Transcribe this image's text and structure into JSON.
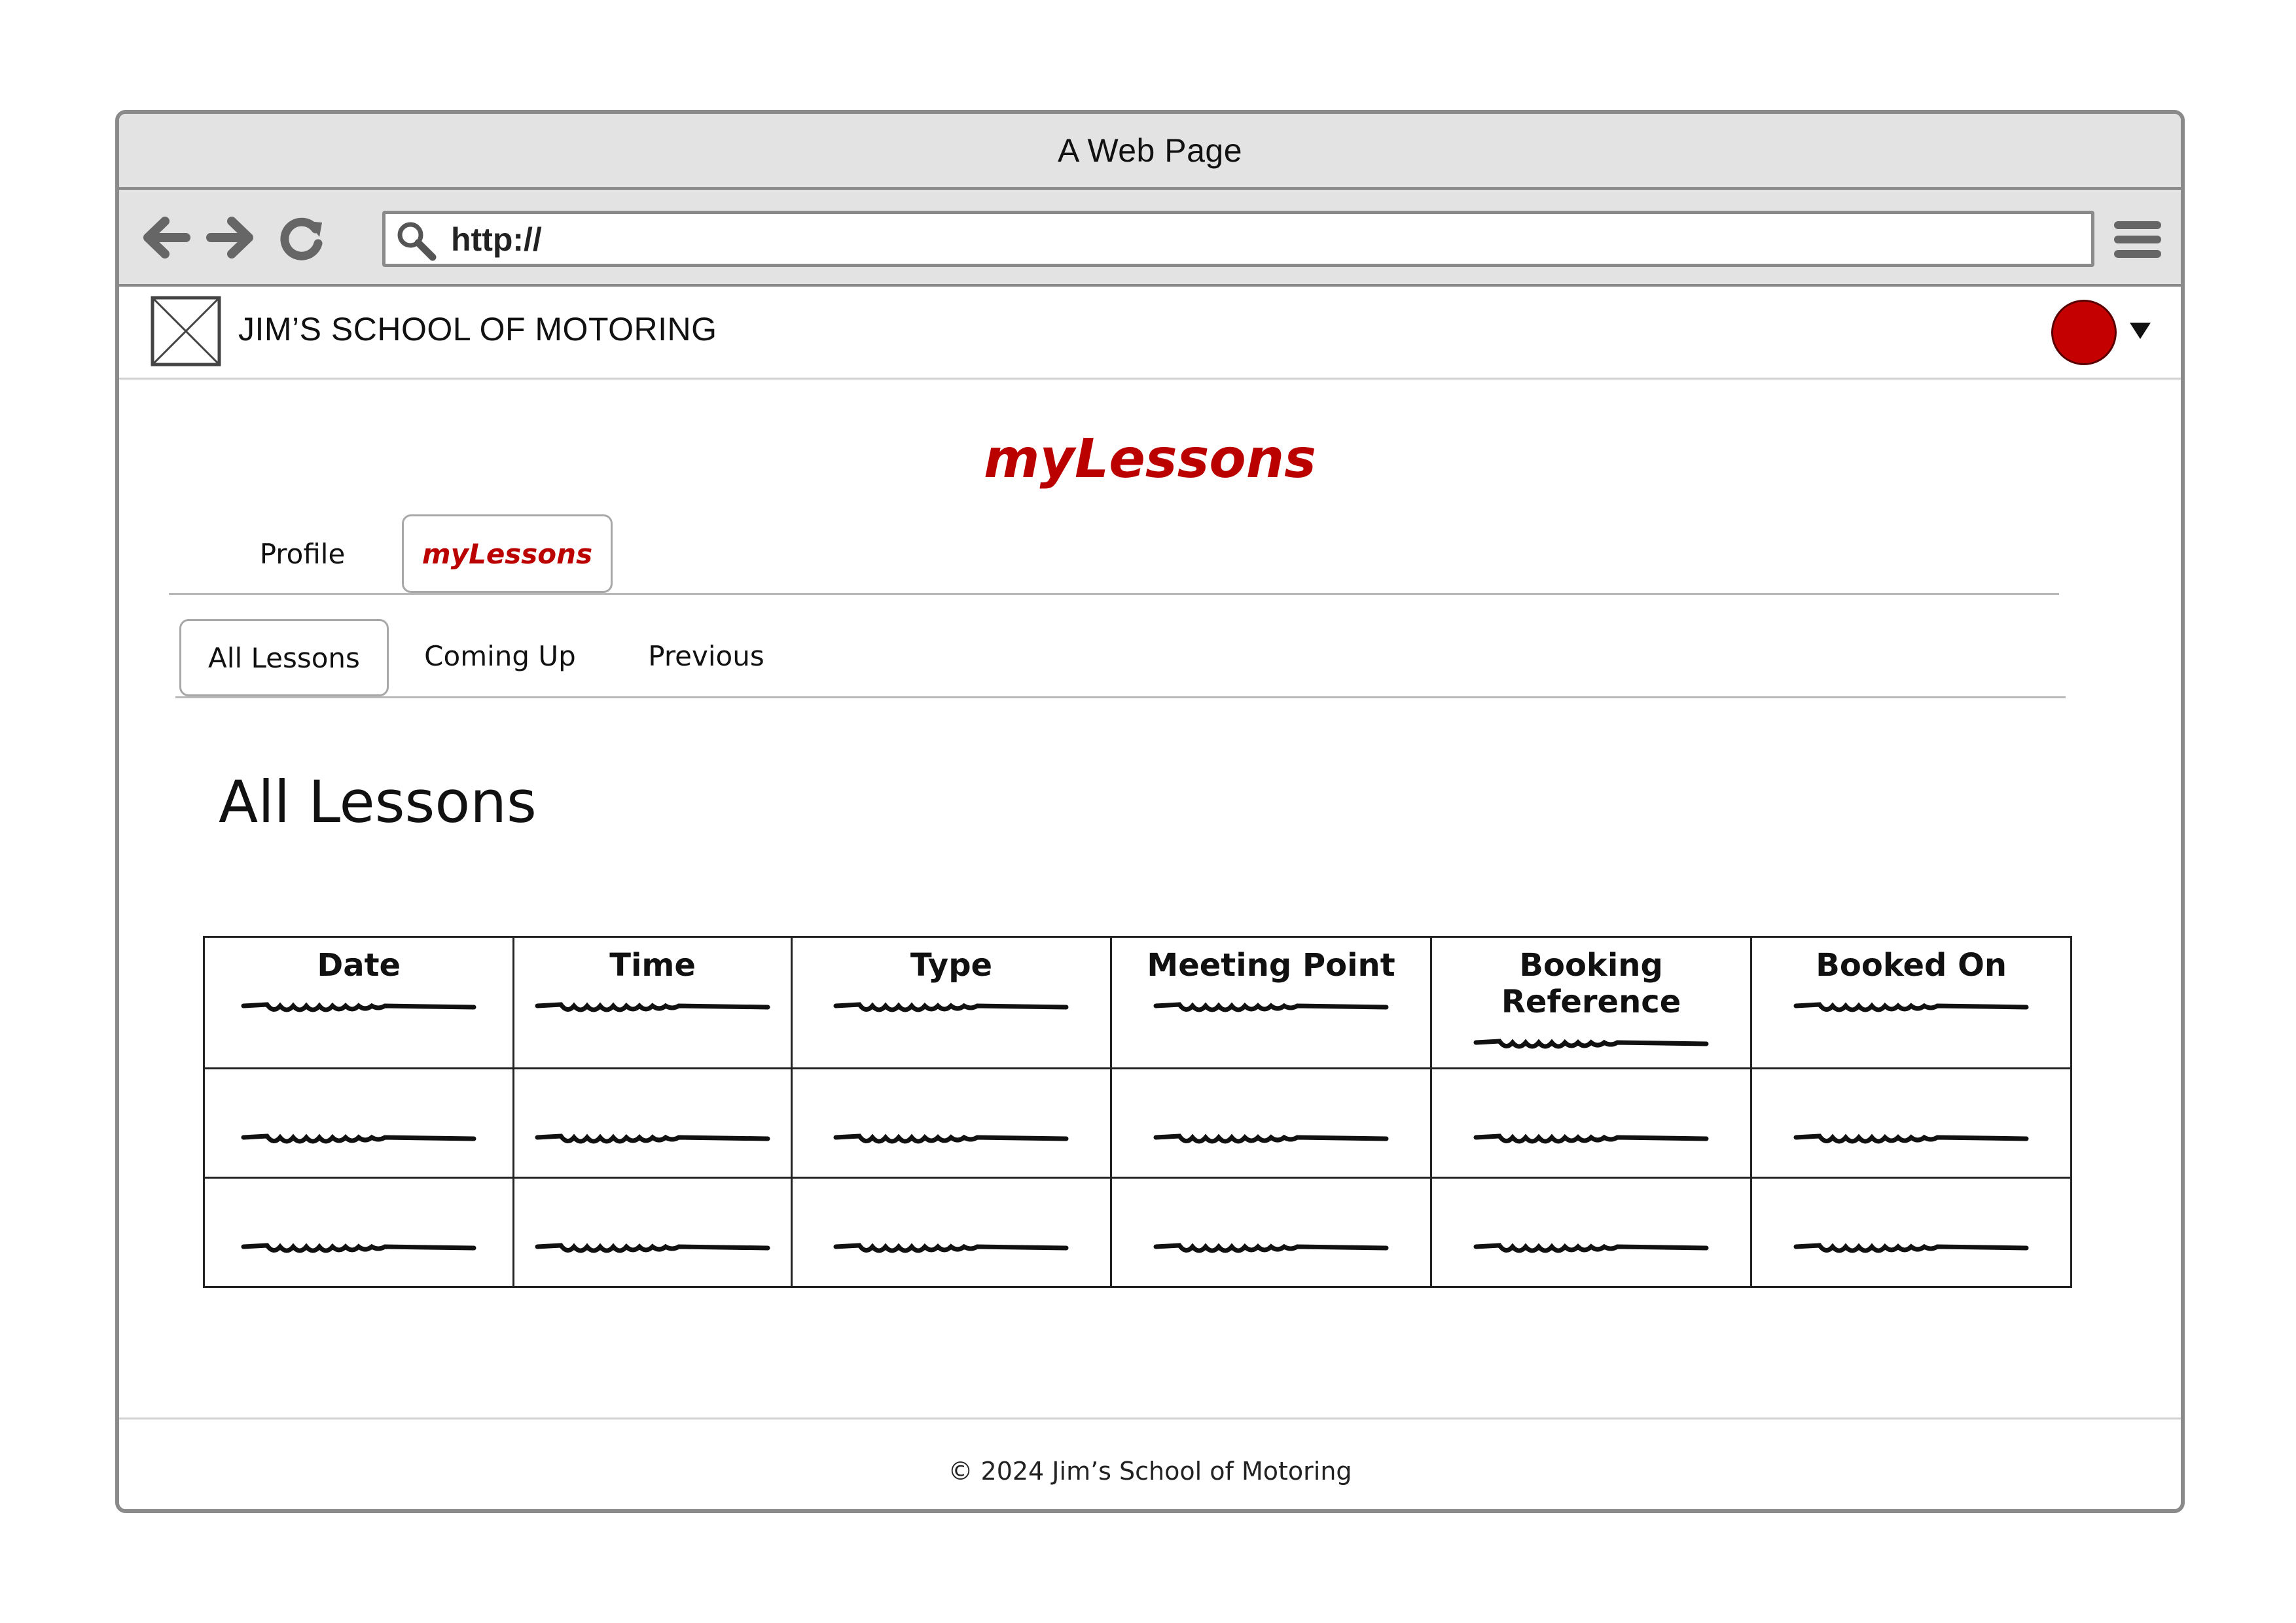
{
  "window": {
    "title": "A Web Page"
  },
  "toolbar": {
    "url": "http://"
  },
  "site": {
    "name": "JIM’S SCHOOL OF MOTORING"
  },
  "page": {
    "title": "myLessons"
  },
  "tabs": [
    {
      "label": "Profile"
    },
    {
      "label": "myLessons",
      "active": true
    }
  ],
  "subtabs": [
    {
      "label": "All Lessons",
      "active": true
    },
    {
      "label": "Coming Up"
    },
    {
      "label": "Previous"
    }
  ],
  "section": {
    "heading": "All Lessons"
  },
  "table": {
    "headers": [
      "Date",
      "Time",
      "Type",
      "Meeting Point",
      "Booking Reference",
      "Booked On"
    ]
  },
  "footer": {
    "text": "© 2024 Jim’s School of Motoring"
  },
  "colors": {
    "accent": "#bb0000",
    "avatar": "#c40000"
  }
}
